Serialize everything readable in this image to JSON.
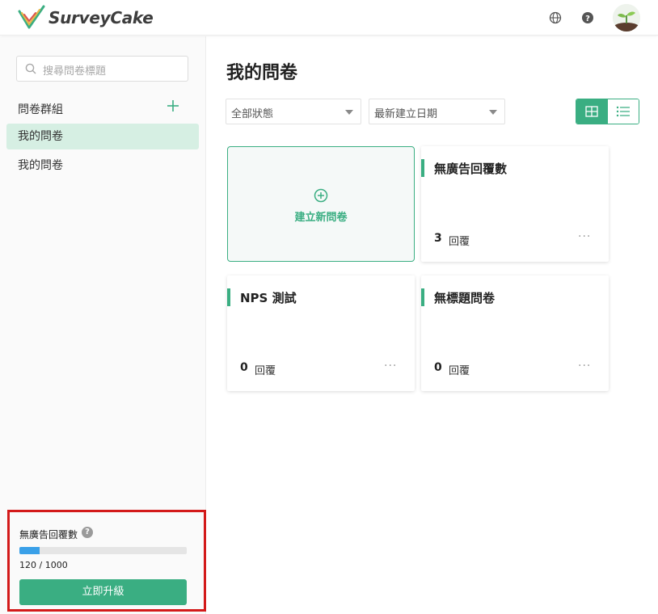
{
  "colors": {
    "accent": "#3aae82",
    "active_bg": "#d6efe3",
    "progress": "#3aa0e8",
    "highlight": "#d31a1a"
  },
  "header": {
    "brand": "SurveyCake"
  },
  "sidebar": {
    "search_placeholder": "搜尋問卷標題",
    "group_title": "問卷群組",
    "items": [
      {
        "label": "我的問卷",
        "active": true
      },
      {
        "label": "我的問卷",
        "active": false
      }
    ],
    "quota": {
      "title": "無廣告回覆數",
      "help": "?",
      "used": 120,
      "total": 1000,
      "text": "120 / 1000",
      "upgrade_label": "立即升級"
    }
  },
  "main": {
    "title": "我的問卷",
    "filter_status": "全部狀態",
    "sort": "最新建立日期",
    "view_mode": "grid",
    "new_card_label": "建立新問卷",
    "unit": "回覆",
    "surveys": [
      {
        "title": "無廣告回覆數",
        "count": "3"
      },
      {
        "title": "NPS 測試",
        "count": "0"
      },
      {
        "title": "無標題問卷",
        "count": "0"
      }
    ]
  }
}
